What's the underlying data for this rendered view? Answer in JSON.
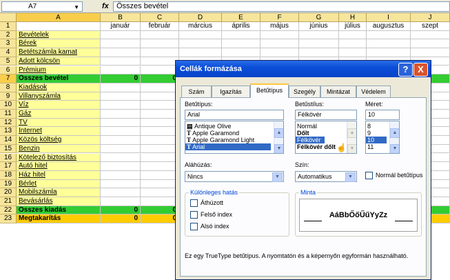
{
  "formula_bar": {
    "name_box": "A7",
    "fx": "fx",
    "content": "Összes bevétel"
  },
  "columns": {
    "A": "A",
    "B": "B",
    "C": "C",
    "D": "D",
    "E": "E",
    "F": "F",
    "G": "G",
    "H": "H",
    "I": "I",
    "J": "J"
  },
  "months": {
    "B": "január",
    "C": "február",
    "D": "március",
    "E": "április",
    "F": "május",
    "G": "június",
    "H": "július",
    "I": "augusztus",
    "J": "szept"
  },
  "rows": [
    {
      "n": "1",
      "label": ""
    },
    {
      "n": "2",
      "label": "Bevételek"
    },
    {
      "n": "3",
      "label": "Bérek"
    },
    {
      "n": "4",
      "label": "Betétszámla kamat"
    },
    {
      "n": "5",
      "label": "Adott kölcsön"
    },
    {
      "n": "6",
      "label": "Prémium"
    },
    {
      "n": "7",
      "label": "Összes bevétel",
      "b": "0",
      "c": "0"
    },
    {
      "n": "8",
      "label": "Kiadások"
    },
    {
      "n": "9",
      "label": "Villanyszámla"
    },
    {
      "n": "10",
      "label": "Víz"
    },
    {
      "n": "11",
      "label": "Gáz"
    },
    {
      "n": "12",
      "label": "TV"
    },
    {
      "n": "13",
      "label": "Internet"
    },
    {
      "n": "14",
      "label": "Közös költség"
    },
    {
      "n": "15",
      "label": "Benzin"
    },
    {
      "n": "16",
      "label": "Kötelező biztosítás"
    },
    {
      "n": "17",
      "label": "Autó hitel"
    },
    {
      "n": "18",
      "label": "Ház hitel"
    },
    {
      "n": "19",
      "label": "Bérlet"
    },
    {
      "n": "20",
      "label": "Mobilszámla"
    },
    {
      "n": "21",
      "label": "Bevásárlás"
    },
    {
      "n": "22",
      "label": "Összes kiadás",
      "b": "0",
      "c": "0"
    },
    {
      "n": "23",
      "label": "Megtakarítás",
      "b": "0",
      "c": "0"
    }
  ],
  "dialog": {
    "title": "Cellák formázása",
    "help": "?",
    "close": "X",
    "tabs": [
      "Szám",
      "Igazítás",
      "Betűtípus",
      "Szegély",
      "Mintázat",
      "Védelem"
    ],
    "font_label": "Betűtípus:",
    "font_value": "Arial",
    "font_list": [
      "Antique Olive",
      "Apple Garamond",
      "Apple Garamond Light",
      "Arial"
    ],
    "style_label": "Betűstílus:",
    "style_value": "Félkövér",
    "style_list": [
      "Normál",
      "Dőlt",
      "Félkövér",
      "Félkövér dőlt"
    ],
    "size_label": "Méret:",
    "size_value": "10",
    "size_list": [
      "8",
      "9",
      "10",
      "11"
    ],
    "underline_label": "Aláhúzás:",
    "underline_value": "Nincs",
    "color_label": "Szín:",
    "color_value": "Automatikus",
    "normal_font_label": "Normál betűtípus",
    "effects_label": "Különleges hatás",
    "effects": [
      "Áthúzott",
      "Felső index",
      "Alsó index"
    ],
    "preview_label": "Minta",
    "preview_text": "AáBbŐőŰűYyZz",
    "footer": "Ez egy TrueType betűtípus. A nyomtatón és a képernyőn egyformán használható."
  }
}
